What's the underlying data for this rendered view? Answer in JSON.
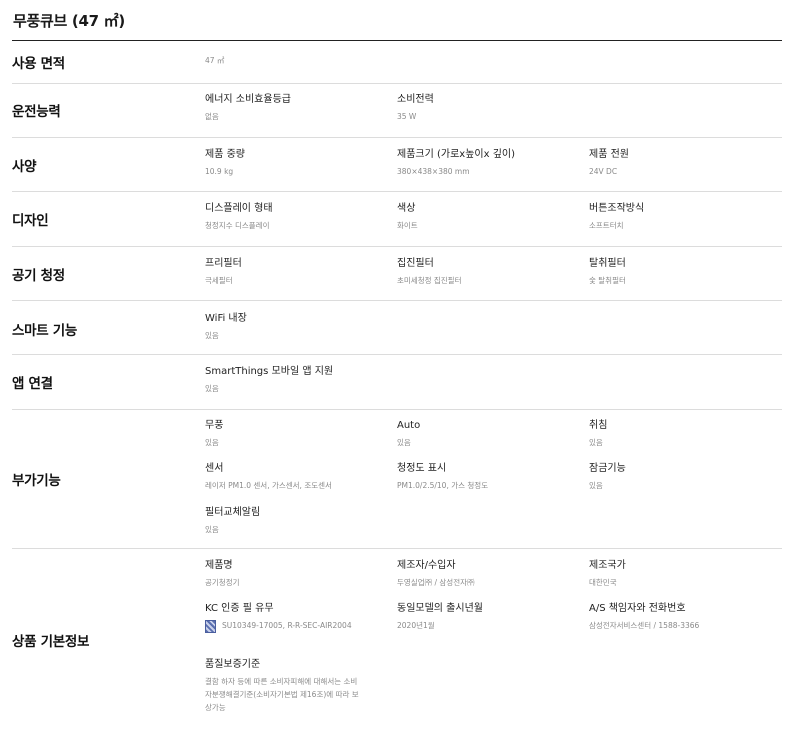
{
  "title": "무풍큐브 (47 ㎡)",
  "sections": [
    {
      "label": "사용 면적",
      "items": [
        {
          "name": "",
          "value": "47 ㎡"
        }
      ]
    },
    {
      "label": "운전능력",
      "items": [
        {
          "name": "에너지 소비효율등급",
          "value": "없음"
        },
        {
          "name": "소비전력",
          "value": "35 W"
        }
      ]
    },
    {
      "label": "사양",
      "items": [
        {
          "name": "제품 중량",
          "value": "10.9 kg"
        },
        {
          "name": "제품크기 (가로x높이x 깊이)",
          "value": "380×438×380 mm"
        },
        {
          "name": "제품 전원",
          "value": "24V DC"
        }
      ]
    },
    {
      "label": "디자인",
      "items": [
        {
          "name": "디스플레이 형태",
          "value": "청정지수 디스플레이"
        },
        {
          "name": "색상",
          "value": "화이트"
        },
        {
          "name": "버튼조작방식",
          "value": "소프트터치"
        }
      ]
    },
    {
      "label": "공기 청정",
      "items": [
        {
          "name": "프리필터",
          "value": "극세필터"
        },
        {
          "name": "집진필터",
          "value": "초미세청정 집진필터"
        },
        {
          "name": "탈취필터",
          "value": "숯 탈취필터"
        }
      ]
    },
    {
      "label": "스마트 기능",
      "items": [
        {
          "name": "WiFi 내장",
          "value": "있음"
        }
      ]
    },
    {
      "label": "앱 연결",
      "items": [
        {
          "name": "SmartThings 모바일 앱 지원",
          "value": "있음"
        }
      ]
    },
    {
      "label": "부가기능",
      "items": [
        {
          "name": "무풍",
          "value": "있음"
        },
        {
          "name": "Auto",
          "value": "있음"
        },
        {
          "name": "취침",
          "value": "있음"
        },
        {
          "name": "센서",
          "value": "레이저 PM1.0 센서, 가스센서, 조도센서"
        },
        {
          "name": "청정도 표시",
          "value": "PM1.0/2.5/10, 가스 청정도"
        },
        {
          "name": "잠금기능",
          "value": "있음"
        },
        {
          "name": "필터교체알림",
          "value": "있음"
        }
      ]
    },
    {
      "label": "상품 기본정보",
      "items": [
        {
          "name": "제품명",
          "value": "공기청정기"
        },
        {
          "name": "제조자/수입자",
          "value": "두영실업㈜ / 삼성전자㈜"
        },
        {
          "name": "제조국가",
          "value": "대한민국"
        },
        {
          "name": "KC 인증 필 유무",
          "value": "SU10349-17005, R-R-SEC-AIR2004"
        },
        {
          "name": "동일모델의 출시년월",
          "value": "2020년1월"
        },
        {
          "name": "A/S 책임자와 전화번호",
          "value": "삼성전자서비스센터 / 1588-3366"
        },
        {
          "name": "품질보증기준",
          "value": "결함 하자 등에 따른 소비자피해에 대해서는 소비자분쟁해결기준(소비자기본법 제16조)에 따라 보상가능"
        }
      ]
    }
  ]
}
